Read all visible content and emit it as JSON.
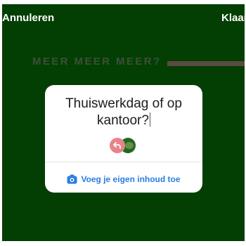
{
  "header": {
    "cancel_label": "Annuleren",
    "done_label": "Klaar"
  },
  "background": {
    "text": "MEER MEER MEER?",
    "color": "#033f02"
  },
  "question_card": {
    "question": "Thuiswerkdag of op kantoor?",
    "add_content_label": "Voeg je eigen inhoud toe",
    "accent_color": "#2a7de1"
  },
  "icons": {
    "pink_avatar": "reply-arrow-icon",
    "green_avatar": "profile-avatar",
    "add_content": "camera-icon"
  }
}
